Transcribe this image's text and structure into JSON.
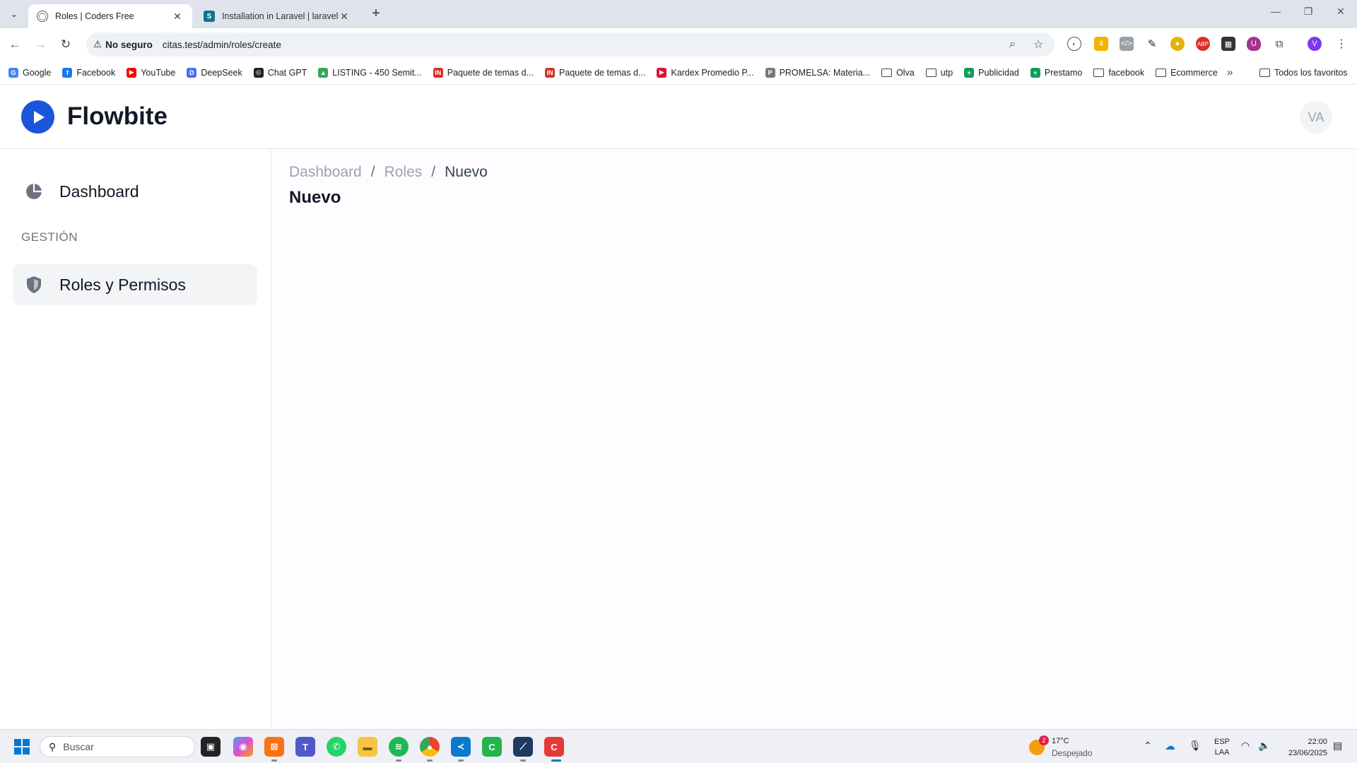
{
  "browser": {
    "tabs": [
      {
        "title": "Roles | Coders Free",
        "active": true
      },
      {
        "title": "Installation in Laravel | laravel-p",
        "active": false,
        "favicon_letter": "S"
      }
    ],
    "security_label": "No seguro",
    "url": "citas.test/admin/roles/create",
    "bookmarks": [
      {
        "label": "Google",
        "type": "site",
        "color": "#4285f4",
        "letter": "G"
      },
      {
        "label": "Facebook",
        "type": "site",
        "color": "#1877f2",
        "letter": "f"
      },
      {
        "label": "YouTube",
        "type": "site",
        "color": "#ff0000",
        "letter": "▶"
      },
      {
        "label": "DeepSeek",
        "type": "site",
        "color": "#4d6bfe",
        "letter": "D"
      },
      {
        "label": "Chat GPT",
        "type": "site",
        "color": "#222222",
        "letter": "◎"
      },
      {
        "label": "LISTING - 450 Semit...",
        "type": "site",
        "color": "#34a853",
        "letter": "▲"
      },
      {
        "label": "Paquete de temas d...",
        "type": "site",
        "color": "#d93025",
        "letter": "IN"
      },
      {
        "label": "Paquete de temas d...",
        "type": "site",
        "color": "#d93025",
        "letter": "IN"
      },
      {
        "label": "Kardex Promedio P...",
        "type": "site",
        "color": "#e0102f",
        "letter": "▶"
      },
      {
        "label": "PROMELSA: Materia...",
        "type": "site",
        "color": "#777777",
        "letter": "P"
      },
      {
        "label": "Olva",
        "type": "folder"
      },
      {
        "label": "utp",
        "type": "folder"
      },
      {
        "label": "Publicidad",
        "type": "site",
        "color": "#0f9d58",
        "letter": "+"
      },
      {
        "label": "Prestamo",
        "type": "site",
        "color": "#0f9d58",
        "letter": "+"
      },
      {
        "label": "facebook",
        "type": "folder"
      },
      {
        "label": "Ecommerce",
        "type": "folder"
      }
    ],
    "all_bookmarks_label": "Todos los favoritos"
  },
  "app": {
    "brand": "Flowbite",
    "avatar_initials": "VA",
    "sidebar": {
      "items": [
        {
          "label": "Dashboard",
          "icon": "chart-pie-icon"
        }
      ],
      "section_heading": "GESTIÓN",
      "section_items": [
        {
          "label": "Roles y Permisos",
          "icon": "shield-icon"
        }
      ]
    },
    "breadcrumb": [
      "Dashboard",
      "Roles",
      "Nuevo"
    ],
    "breadcrumb_separator": "/",
    "page_title": "Nuevo"
  },
  "taskbar": {
    "search_placeholder": "Buscar",
    "weather_temp": "17°C",
    "weather_desc": "Despejado",
    "weather_badge": "2",
    "lang_top": "ESP",
    "lang_bottom": "LAA",
    "time": "22:00",
    "date": "23/06/2025"
  }
}
